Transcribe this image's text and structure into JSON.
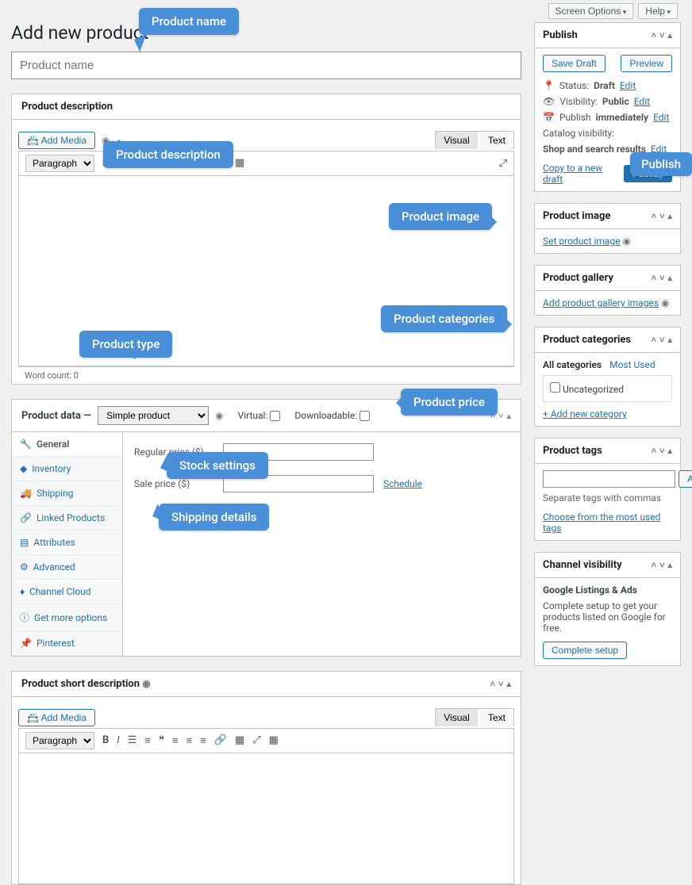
{
  "top": {
    "screen_options": "Screen Options",
    "help": "Help"
  },
  "page_title": "Add new product",
  "title_placeholder": "Product name",
  "desc": {
    "title": "Product description",
    "add_media": "Add Media",
    "visual": "Visual",
    "text": "Text",
    "paragraph": "Paragraph",
    "word_count": "Word count: 0"
  },
  "pd": {
    "title": "Product data —",
    "select": "Simple product",
    "virtual": "Virtual:",
    "downloadable": "Downloadable:",
    "tabs": [
      "General",
      "Inventory",
      "Shipping",
      "Linked Products",
      "Attributes",
      "Advanced",
      "Channel Cloud",
      "Get more options",
      "Pinterest"
    ],
    "regular_price": "Regular price ($)",
    "sale_price": "Sale price ($)",
    "schedule": "Schedule"
  },
  "short_desc": {
    "title": "Product short description"
  },
  "publish": {
    "title": "Publish",
    "save_draft": "Save Draft",
    "preview": "Preview",
    "status_label": "Status:",
    "status_val": "Draft",
    "edit": "Edit",
    "vis_label": "Visibility:",
    "vis_val": "Public",
    "pub_label": "Publish",
    "pub_val": "immediately",
    "catalog_label": "Catalog visibility:",
    "catalog_val": "Shop and search results",
    "copy": "Copy to a new draft",
    "publish_btn": "Publish"
  },
  "pimage": {
    "title": "Product image",
    "set": "Set product image"
  },
  "pgallery": {
    "title": "Product gallery",
    "add": "Add product gallery images"
  },
  "pcat": {
    "title": "Product categories",
    "all": "All categories",
    "most": "Most Used",
    "uncat": "Uncategorized",
    "add_new": "+ Add new category"
  },
  "ptags": {
    "title": "Product tags",
    "add": "Add",
    "separate": "Separate tags with commas",
    "choose": "Choose from the most used tags"
  },
  "channel": {
    "title": "Channel visibility",
    "gla": "Google Listings & Ads",
    "desc": "Complete setup to get your products listed on Google for free.",
    "btn": "Complete setup"
  },
  "tooltips": {
    "name": "Product name",
    "desc": "Product description",
    "type": "Product type",
    "image": "Product image",
    "categories": "Product categories",
    "publish": "Publish",
    "price": "Product price",
    "stock": "Stock settings",
    "shipping": "Shipping details"
  }
}
